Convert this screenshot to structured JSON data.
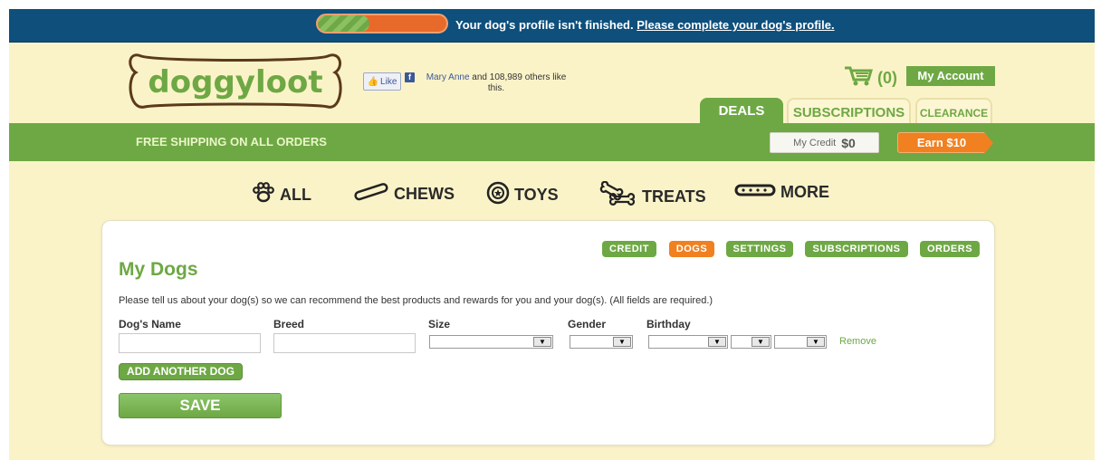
{
  "notice": {
    "progress_fraction": 0.4,
    "message": "Your dog's profile isn't finished.",
    "link": "Please complete your dog's profile."
  },
  "header": {
    "logo_text": "doggyloot",
    "like_button": "Like",
    "fb_icon": "f",
    "like_name": "Mary Anne",
    "like_rest": " and 108,989 others like this.",
    "cart_count": "(0)",
    "my_account": "My Account",
    "tabs": {
      "deals": "DEALS",
      "subscriptions": "SUBSCRIPTIONS",
      "clearance": "CLEARANCE"
    },
    "free_shipping": "FREE SHIPPING ON ALL ORDERS",
    "credit_label": "My Credit",
    "credit_amount": "$0",
    "earn": "Earn $10"
  },
  "categories": {
    "all": "ALL",
    "chews": "CHEWS",
    "toys": "TOYS",
    "treats": "TREATS",
    "more": "MORE"
  },
  "account_nav": {
    "credit": "CREDIT",
    "dogs": "DOGS",
    "settings": "SETTINGS",
    "subscriptions": "SUBSCRIPTIONS",
    "orders": "ORDERS"
  },
  "main": {
    "title": "My Dogs",
    "intro": "Please tell us about your dog(s) so we can recommend the best products and rewards for you and your dog(s). (All fields are required.)",
    "labels": {
      "name": "Dog's Name",
      "breed": "Breed",
      "size": "Size",
      "gender": "Gender",
      "birthday": "Birthday"
    },
    "values": {
      "name": "",
      "breed": "",
      "size": "",
      "gender": "",
      "month": "",
      "day": "",
      "year": ""
    },
    "remove": "Remove",
    "add_another": "ADD ANOTHER DOG",
    "save": "SAVE"
  },
  "colors": {
    "brand_green": "#6ea844",
    "accent_orange": "#f08020",
    "notice_blue": "#0e4f7c",
    "page_bg": "#fbf3c8"
  }
}
